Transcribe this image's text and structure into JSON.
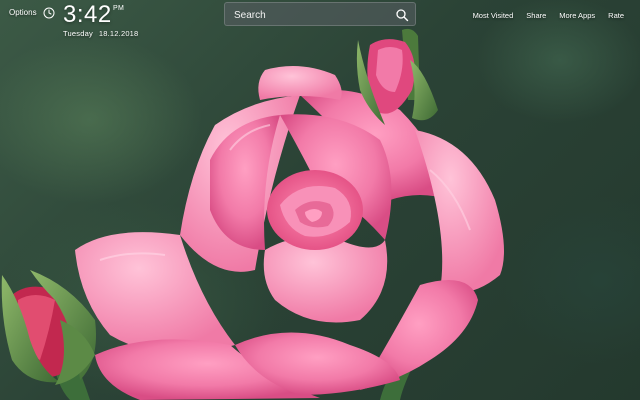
{
  "header": {
    "options_label": "Options",
    "time": "3:42",
    "ampm": "PM",
    "day": "Tuesday",
    "date": "18.12.2018"
  },
  "search": {
    "placeholder": "Search"
  },
  "nav": {
    "most_visited": "Most Visited",
    "share": "Share",
    "more_apps": "More Apps",
    "rate": "Rate"
  },
  "icons": {
    "clock": "clock-icon",
    "search": "search-icon"
  },
  "colors": {
    "petal_pink": "#f27aa8",
    "petal_dark": "#e0487e",
    "leaf_green": "#4c7a3c",
    "background_green": "#2f4a3a"
  }
}
